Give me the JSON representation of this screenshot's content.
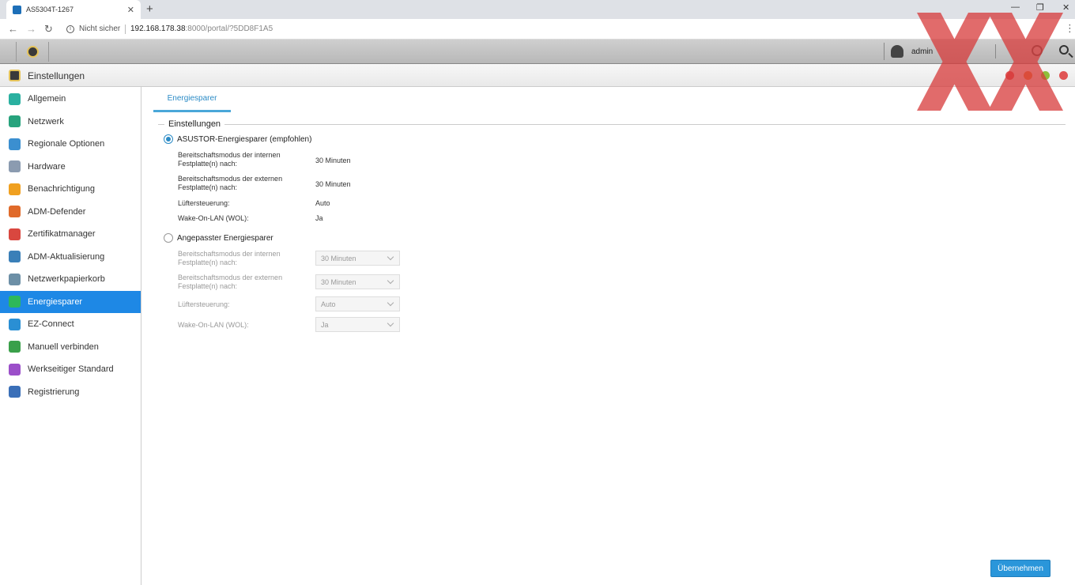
{
  "browser": {
    "tab_title": "AS5304T-1267",
    "tab_close": "✕",
    "new_tab": "+",
    "window_controls": {
      "minimize": "—",
      "restore": "❐",
      "close": "✕"
    },
    "security_label": "Nicht sicher",
    "url_host": "192.168.178.38",
    "url_path": ":8000/portal/?5DD8F1A5"
  },
  "adm": {
    "user_name": "admin"
  },
  "window": {
    "title": "Einstellungen",
    "dot_colors": [
      "#e05454",
      "#e8833a",
      "#8fbf3a",
      "#e05454"
    ]
  },
  "sidebar": {
    "items": [
      {
        "label": "Allgemein",
        "icon": "general-icon",
        "color": "#2ab0a0"
      },
      {
        "label": "Netzwerk",
        "icon": "globe-icon",
        "color": "#27a37d"
      },
      {
        "label": "Regionale Optionen",
        "icon": "region-icon",
        "color": "#3b8fd0"
      },
      {
        "label": "Hardware",
        "icon": "hardware-icon",
        "color": "#8b9bb0"
      },
      {
        "label": "Benachrichtigung",
        "icon": "notification-icon",
        "color": "#f0a020"
      },
      {
        "label": "ADM-Defender",
        "icon": "firewall-icon",
        "color": "#e06a2a"
      },
      {
        "label": "Zertifikatmanager",
        "icon": "certificate-icon",
        "color": "#d9473f"
      },
      {
        "label": "ADM-Aktualisierung",
        "icon": "update-icon",
        "color": "#3a7fb8"
      },
      {
        "label": "Netzwerkpapierkorb",
        "icon": "recycle-bin-icon",
        "color": "#6c8fa6"
      },
      {
        "label": "Energiesparer",
        "icon": "energy-saver-icon",
        "color": "#2eb85a",
        "active": true
      },
      {
        "label": "EZ-Connect",
        "icon": "cloud-icon",
        "color": "#2a8fd4"
      },
      {
        "label": "Manuell verbinden",
        "icon": "connect-icon",
        "color": "#3aa04a"
      },
      {
        "label": "Werkseitiger Standard",
        "icon": "reset-icon",
        "color": "#9b4fc9"
      },
      {
        "label": "Registrierung",
        "icon": "registration-icon",
        "color": "#3a6fb8"
      }
    ]
  },
  "content": {
    "tab_label": "Energiesparer",
    "legend": "Einstellungen",
    "asustor": {
      "label": "ASUSTOR-Energiesparer (empfohlen)",
      "checked": true,
      "rows": [
        {
          "label": "Bereitschaftsmodus der internen Festplatte(n) nach:",
          "value": "30 Minuten"
        },
        {
          "label": "Bereitschaftsmodus der externen Festplatte(n) nach:",
          "value": "30 Minuten"
        },
        {
          "label": "Lüftersteuerung:",
          "value": "Auto"
        },
        {
          "label": "Wake-On-LAN (WOL):",
          "value": "Ja"
        }
      ]
    },
    "custom": {
      "label": "Angepasster Energiesparer",
      "checked": false,
      "rows": [
        {
          "label": "Bereitschaftsmodus der internen Festplatte(n) nach:",
          "value": "30 Minuten"
        },
        {
          "label": "Bereitschaftsmodus der externen Festplatte(n) nach:",
          "value": "30 Minuten"
        },
        {
          "label": "Lüftersteuerung:",
          "value": "Auto"
        },
        {
          "label": "Wake-On-LAN (WOL):",
          "value": "Ja"
        }
      ]
    },
    "apply_label": "Übernehmen"
  }
}
